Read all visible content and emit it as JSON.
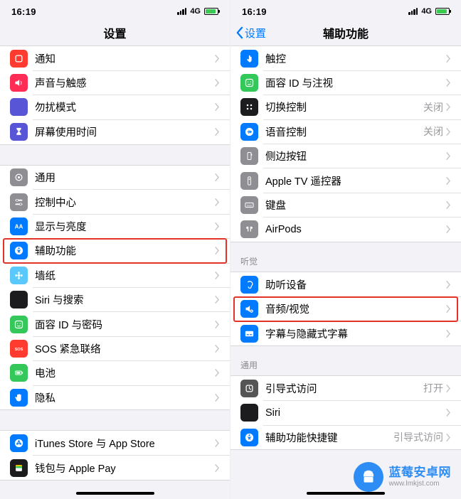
{
  "status": {
    "time": "16:19",
    "carrier": "4G"
  },
  "left": {
    "title": "设置",
    "g1": [
      {
        "k": "通知",
        "ic": "bell",
        "c": "c-red"
      },
      {
        "k": "声音与触感",
        "ic": "speaker",
        "c": "c-pink"
      },
      {
        "k": "勿扰模式",
        "ic": "moon",
        "c": "c-purple"
      },
      {
        "k": "屏幕使用时间",
        "ic": "hourglass",
        "c": "c-purple"
      }
    ],
    "g2": [
      {
        "k": "通用",
        "ic": "gear",
        "c": "c-gray"
      },
      {
        "k": "控制中心",
        "ic": "switches",
        "c": "c-gray"
      },
      {
        "k": "显示与亮度",
        "ic": "aa",
        "c": "c-blue"
      },
      {
        "k": "辅助功能",
        "ic": "access",
        "c": "c-blue",
        "hl": true
      },
      {
        "k": "墙纸",
        "ic": "flower",
        "c": "c-ltblue"
      },
      {
        "k": "Siri 与搜索",
        "ic": "siri",
        "c": "c-black"
      },
      {
        "k": "面容 ID 与密码",
        "ic": "face",
        "c": "c-green"
      },
      {
        "k": "SOS 紧急联络",
        "ic": "sos",
        "c": "c-red"
      },
      {
        "k": "电池",
        "ic": "battery",
        "c": "c-green"
      },
      {
        "k": "隐私",
        "ic": "hand",
        "c": "c-blue"
      }
    ],
    "g3": [
      {
        "k": "iTunes Store 与 App Store",
        "ic": "appstore",
        "c": "c-blue"
      },
      {
        "k": "钱包与 Apple Pay",
        "ic": "wallet",
        "c": "c-black"
      }
    ]
  },
  "right": {
    "back": "设置",
    "title": "辅助功能",
    "g1": [
      {
        "k": "触控",
        "ic": "touch",
        "c": "c-blue"
      },
      {
        "k": "面容 ID 与注视",
        "ic": "face",
        "c": "c-green"
      },
      {
        "k": "切换控制",
        "ic": "switch",
        "c": "c-black",
        "d": "关闭"
      },
      {
        "k": "语音控制",
        "ic": "voice",
        "c": "c-blue",
        "d": "关闭"
      },
      {
        "k": "侧边按钮",
        "ic": "side",
        "c": "c-gray"
      },
      {
        "k": "Apple TV 遥控器",
        "ic": "remote",
        "c": "c-gray"
      },
      {
        "k": "键盘",
        "ic": "keyboard",
        "c": "c-gray"
      },
      {
        "k": "AirPods",
        "ic": "airpods",
        "c": "c-gray"
      }
    ],
    "h2": "听觉",
    "g2": [
      {
        "k": "助听设备",
        "ic": "ear",
        "c": "c-blue"
      },
      {
        "k": "音频/视觉",
        "ic": "av",
        "c": "c-blue",
        "hl": true
      },
      {
        "k": "字幕与隐藏式字幕",
        "ic": "cc",
        "c": "c-blue"
      }
    ],
    "h3": "通用",
    "g3": [
      {
        "k": "引导式访问",
        "ic": "guided",
        "c": "c-darkgray",
        "d": "打开"
      },
      {
        "k": "Siri",
        "ic": "siri2",
        "c": "c-black"
      },
      {
        "k": "辅助功能快捷键",
        "ic": "shortcut",
        "c": "c-blue",
        "d": "引导式访问"
      }
    ]
  },
  "wm": {
    "name": "蓝莓安卓网",
    "url": "www.lmkjst.com"
  }
}
